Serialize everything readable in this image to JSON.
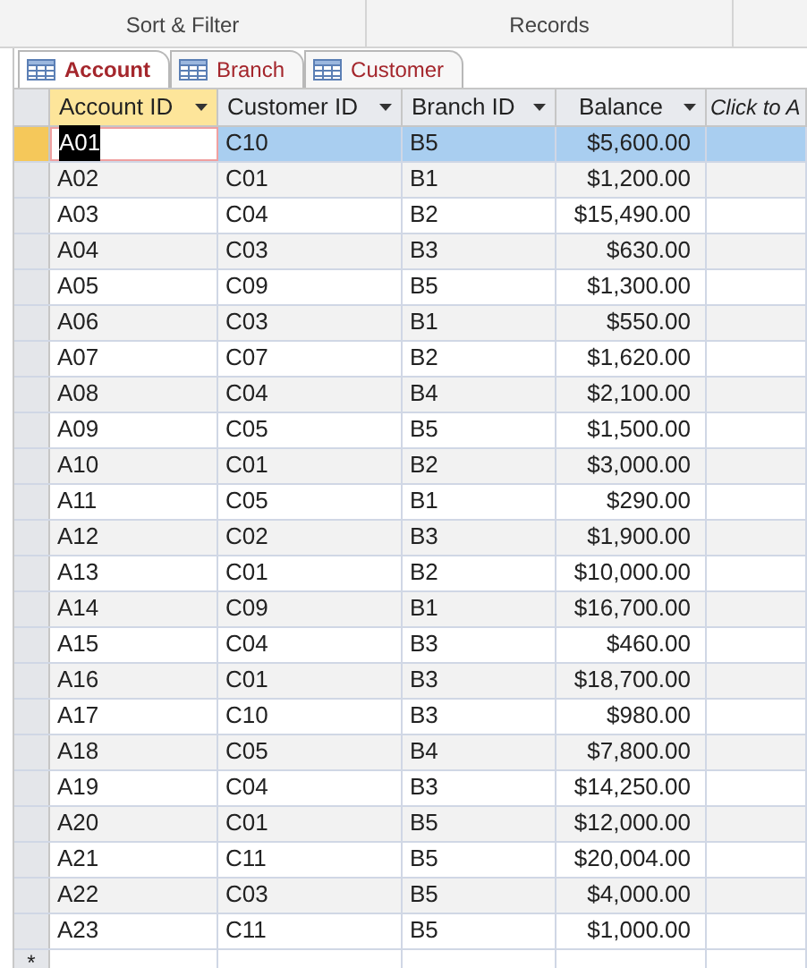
{
  "ribbon": {
    "groups": [
      "Sort & Filter",
      "Records"
    ]
  },
  "tabs": [
    {
      "label": "Account",
      "selected": true
    },
    {
      "label": "Branch",
      "selected": false
    },
    {
      "label": "Customer",
      "selected": false
    }
  ],
  "table": {
    "columns": [
      {
        "label": "Account ID",
        "active": true,
        "kind": "text"
      },
      {
        "label": "Customer ID",
        "active": false,
        "kind": "text"
      },
      {
        "label": "Branch ID",
        "active": false,
        "kind": "text"
      },
      {
        "label": "Balance",
        "active": false,
        "kind": "currency"
      },
      {
        "label": "Click to A",
        "active": false,
        "kind": "add"
      }
    ],
    "rows": [
      {
        "selected": true,
        "cells": [
          "A01",
          "C10",
          "B5",
          "$5,600.00",
          ""
        ]
      },
      {
        "selected": false,
        "cells": [
          "A02",
          "C01",
          "B1",
          "$1,200.00",
          ""
        ]
      },
      {
        "selected": false,
        "cells": [
          "A03",
          "C04",
          "B2",
          "$15,490.00",
          ""
        ]
      },
      {
        "selected": false,
        "cells": [
          "A04",
          "C03",
          "B3",
          "$630.00",
          ""
        ]
      },
      {
        "selected": false,
        "cells": [
          "A05",
          "C09",
          "B5",
          "$1,300.00",
          ""
        ]
      },
      {
        "selected": false,
        "cells": [
          "A06",
          "C03",
          "B1",
          "$550.00",
          ""
        ]
      },
      {
        "selected": false,
        "cells": [
          "A07",
          "C07",
          "B2",
          "$1,620.00",
          ""
        ]
      },
      {
        "selected": false,
        "cells": [
          "A08",
          "C04",
          "B4",
          "$2,100.00",
          ""
        ]
      },
      {
        "selected": false,
        "cells": [
          "A09",
          "C05",
          "B5",
          "$1,500.00",
          ""
        ]
      },
      {
        "selected": false,
        "cells": [
          "A10",
          "C01",
          "B2",
          "$3,000.00",
          ""
        ]
      },
      {
        "selected": false,
        "cells": [
          "A11",
          "C05",
          "B1",
          "$290.00",
          ""
        ]
      },
      {
        "selected": false,
        "cells": [
          "A12",
          "C02",
          "B3",
          "$1,900.00",
          ""
        ]
      },
      {
        "selected": false,
        "cells": [
          "A13",
          "C01",
          "B2",
          "$10,000.00",
          ""
        ]
      },
      {
        "selected": false,
        "cells": [
          "A14",
          "C09",
          "B1",
          "$16,700.00",
          ""
        ]
      },
      {
        "selected": false,
        "cells": [
          "A15",
          "C04",
          "B3",
          "$460.00",
          ""
        ]
      },
      {
        "selected": false,
        "cells": [
          "A16",
          "C01",
          "B3",
          "$18,700.00",
          ""
        ]
      },
      {
        "selected": false,
        "cells": [
          "A17",
          "C10",
          "B3",
          "$980.00",
          ""
        ]
      },
      {
        "selected": false,
        "cells": [
          "A18",
          "C05",
          "B4",
          "$7,800.00",
          ""
        ]
      },
      {
        "selected": false,
        "cells": [
          "A19",
          "C04",
          "B3",
          "$14,250.00",
          ""
        ]
      },
      {
        "selected": false,
        "cells": [
          "A20",
          "C01",
          "B5",
          "$12,000.00",
          ""
        ]
      },
      {
        "selected": false,
        "cells": [
          "A21",
          "C11",
          "B5",
          "$20,004.00",
          ""
        ]
      },
      {
        "selected": false,
        "cells": [
          "A22",
          "C03",
          "B5",
          "$4,000.00",
          ""
        ]
      },
      {
        "selected": false,
        "cells": [
          "A23",
          "C11",
          "B5",
          "$1,000.00",
          ""
        ]
      }
    ],
    "new_row_marker": "*"
  }
}
